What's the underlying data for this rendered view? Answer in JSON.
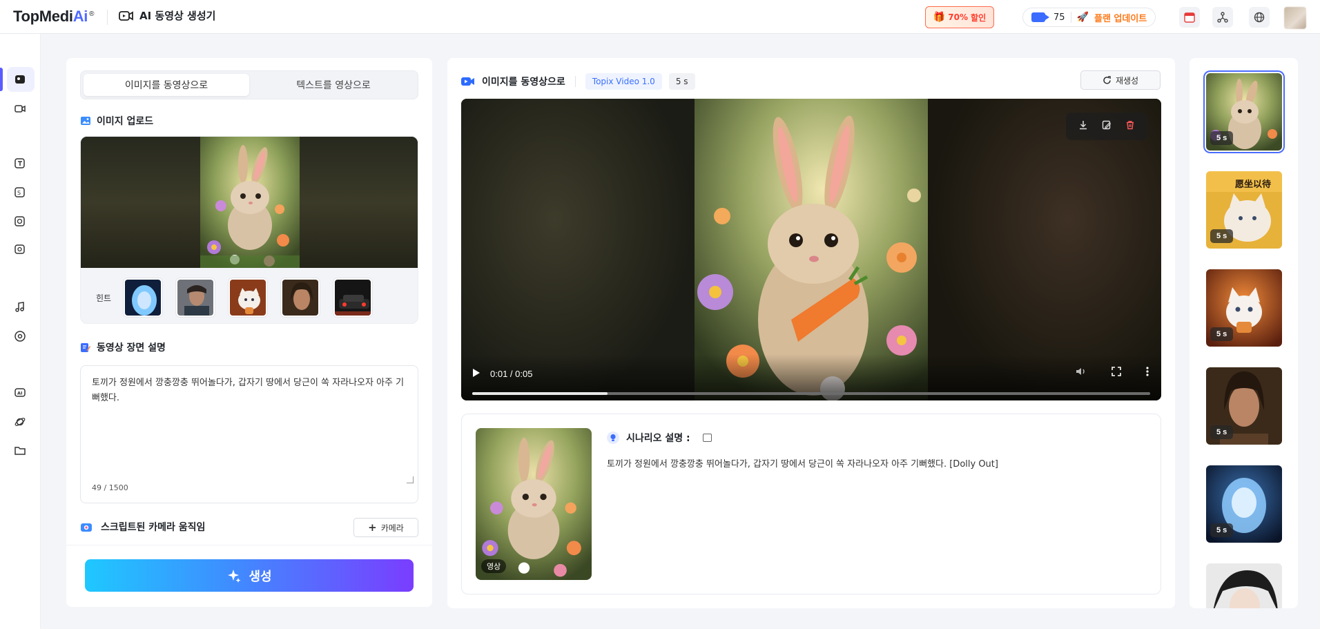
{
  "app": {
    "brand_prefix": "TopMedi",
    "brand_ai": "Ai",
    "brand_reg": "®",
    "tool_title": "AI 동영상 생성기",
    "promo_percent": "70%",
    "promo_label": "할인",
    "credits": "75",
    "upgrade_label": "플랜 업데이트"
  },
  "left": {
    "tab_image": "이미지를 동영상으로",
    "tab_text": "텍스트를 영상으로",
    "upload_title": "이미지 업로드",
    "hint_label": "힌트",
    "desc_title": "동영상 장면 설명",
    "desc_text": "토끼가 정원에서 깡충깡충 뛰어놀다가, 갑자기 땅에서 당근이 쏙 자라나오자 아주 기뻐했다.",
    "counter": "49 / 1500",
    "camera_title": "스크립트된 카메라 움직임",
    "camera_button": "카메라",
    "generate_button": "생성"
  },
  "center": {
    "title": "이미지를 동영상으로",
    "model_tag": "Topix Video 1.0",
    "duration_tag": "5 s",
    "regen_button": "재생성",
    "player": {
      "time": "0:01 / 0:05",
      "progress": 0.2
    },
    "scenario": {
      "title": "시나리오 설명 :",
      "badge": "영상",
      "body": "토끼가 정원에서 깡충깡충 뛰어놀다가, 갑자기 땅에서 당근이 쏙 자라나오자 아주 기뻐했다. [Dolly Out]"
    }
  },
  "history": [
    {
      "duration": "5 s",
      "kind": "rabbit"
    },
    {
      "duration": "5 s",
      "kind": "cat-yellow",
      "caption": "愿坐以待"
    },
    {
      "duration": "5 s",
      "kind": "kitten-fire"
    },
    {
      "duration": "5 s",
      "kind": "man-portrait"
    },
    {
      "duration": "5 s",
      "kind": "blue-girl"
    },
    {
      "duration": "",
      "kind": "anime-man"
    }
  ],
  "colors": {
    "accent": "#4f6bff",
    "generate_gradient_start": "#1fc8ff",
    "generate_gradient_end": "#7a3dff",
    "promo": "#ff3d2e",
    "delete": "#ff5a5a"
  }
}
